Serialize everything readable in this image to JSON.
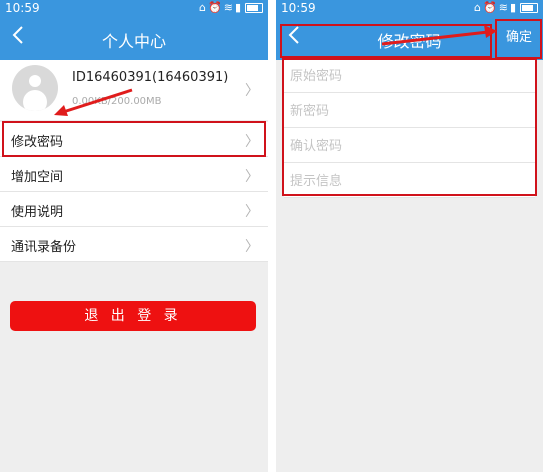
{
  "status_bar": {
    "time": "10:59"
  },
  "left_screen": {
    "title": "个人中心",
    "profile": {
      "user_id": "ID16460391(16460391)",
      "storage": "0.00KB/200.00MB"
    },
    "menu": [
      {
        "label": "修改密码"
      },
      {
        "label": "增加空间"
      },
      {
        "label": "使用说明"
      },
      {
        "label": "通讯录备份"
      }
    ],
    "logout_label": "退 出 登 录"
  },
  "right_screen": {
    "title": "修改密码",
    "confirm_label": "确定",
    "fields": [
      {
        "placeholder": "原始密码"
      },
      {
        "placeholder": "新密码"
      },
      {
        "placeholder": "确认密码"
      },
      {
        "placeholder": "提示信息"
      }
    ]
  },
  "colors": {
    "header": "#3a96de",
    "logout": "#ee1111",
    "annotation": "#d0121b"
  }
}
